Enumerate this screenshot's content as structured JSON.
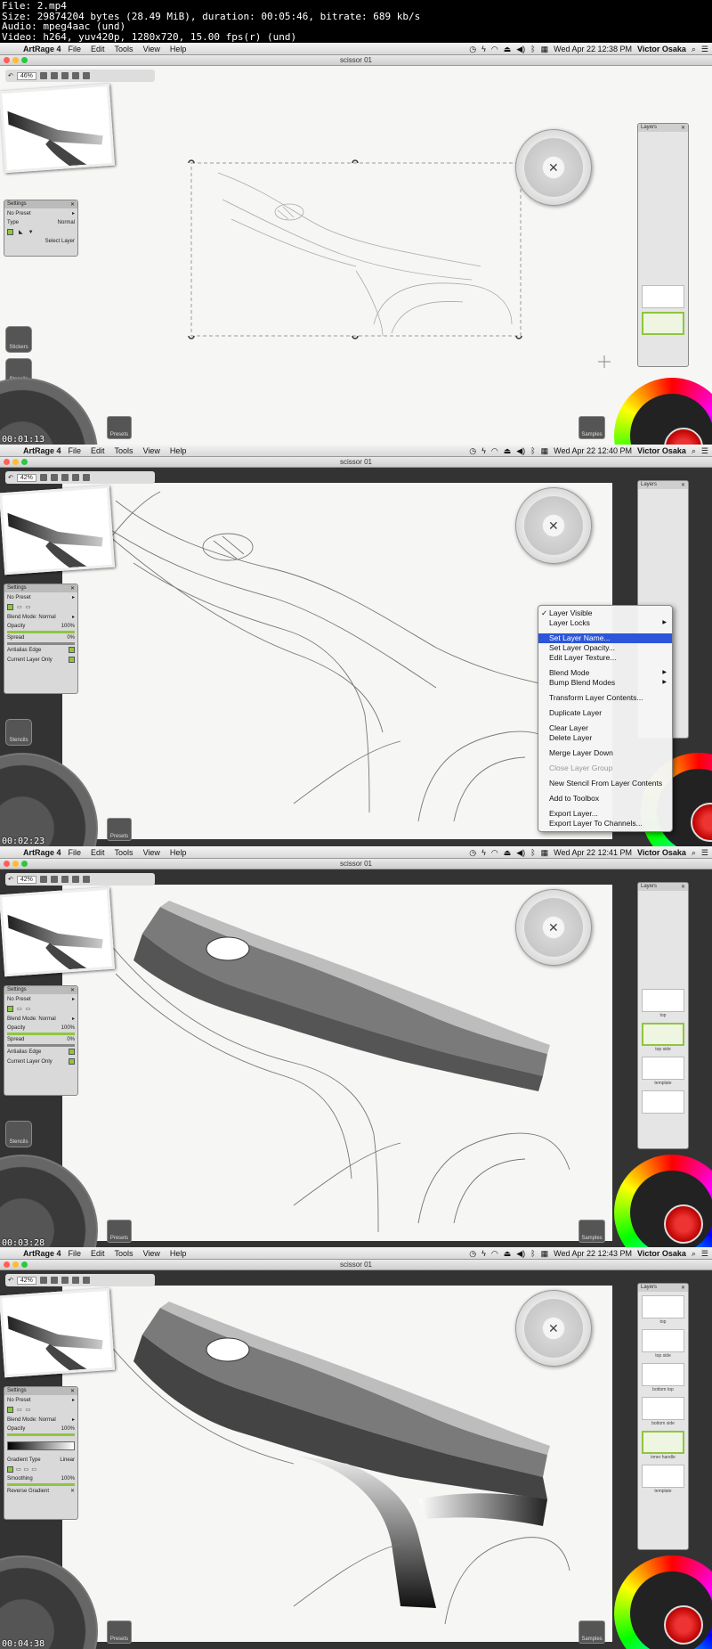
{
  "file_info": {
    "lines": [
      "File: 2.mp4",
      "Size: 29874204 bytes (28.49 MiB), duration: 00:05:46, bitrate: 689 kb/s",
      "Audio: mpeg4aac (und)",
      "Video: h264, yuv420p, 1280x720, 15.00 fps(r) (und)"
    ]
  },
  "menubar": {
    "app_name": "ArtRage 4",
    "items": [
      "File",
      "Edit",
      "Tools",
      "View",
      "Help"
    ],
    "user": "Victor Osaka"
  },
  "window_title": "scissor 01",
  "colors": {
    "accent_green": "#8ec63f",
    "menu_highlight": "#2b56d9",
    "close_light": "#ff5f57",
    "min_light": "#ffbd2e",
    "max_light": "#28c940"
  },
  "frames": [
    {
      "timecode": "00:01:13",
      "clock": "Wed Apr 22 12:38 PM",
      "zoom": "46%",
      "settings": {
        "title": "Settings",
        "preset": "No Preset",
        "type_label": "Type",
        "normal_label": "Normal",
        "select_layer": "Select Layer"
      },
      "side_buttons": [
        "Stickers",
        "Stencils"
      ],
      "layers_title": "Layers",
      "layer_names": []
    },
    {
      "timecode": "00:02:23",
      "clock": "Wed Apr 22 12:40 PM",
      "zoom": "42%",
      "settings": {
        "title": "Settings",
        "preset": "No Preset",
        "blend_mode": "Blend Mode: Normal",
        "opacity_label": "Opacity",
        "opacity_value": "100%",
        "spread_label": "Spread",
        "spread_value": "0%",
        "antialias": "Antialias Edge",
        "current_layer": "Current Layer Only"
      },
      "side_buttons": [
        "Stencils"
      ],
      "layers_title": "Layers",
      "layer_names": [],
      "context_menu": {
        "items": [
          {
            "label": "Layer Visible",
            "check": "✓"
          },
          {
            "label": "Layer Locks",
            "submenu": "▶"
          },
          {
            "sep": true
          },
          {
            "label": "Set Layer Name...",
            "selected": true
          },
          {
            "label": "Set Layer Opacity..."
          },
          {
            "label": "Edit Layer Texture..."
          },
          {
            "sep": true
          },
          {
            "label": "Blend Mode",
            "submenu": "▶"
          },
          {
            "label": "Bump Blend Modes",
            "submenu": "▶"
          },
          {
            "sep": true
          },
          {
            "label": "Transform Layer Contents..."
          },
          {
            "sep": true
          },
          {
            "label": "Duplicate Layer"
          },
          {
            "sep": true
          },
          {
            "label": "Clear Layer"
          },
          {
            "label": "Delete Layer"
          },
          {
            "sep": true
          },
          {
            "label": "Merge Layer Down"
          },
          {
            "sep": true
          },
          {
            "label": "Close Layer Group",
            "disabled": true
          },
          {
            "sep": true
          },
          {
            "label": "New Stencil From Layer Contents"
          },
          {
            "sep": true
          },
          {
            "label": "Add to Toolbox"
          },
          {
            "sep": true
          },
          {
            "label": "Export Layer..."
          },
          {
            "label": "Export Layer To Channels..."
          }
        ]
      }
    },
    {
      "timecode": "00:03:28",
      "clock": "Wed Apr 22 12:41 PM",
      "zoom": "42%",
      "settings": {
        "title": "Settings",
        "preset": "No Preset",
        "blend_mode": "Blend Mode: Normal",
        "opacity_label": "Opacity",
        "opacity_value": "100%",
        "spread_label": "Spread",
        "spread_value": "0%",
        "antialias": "Antialias Edge",
        "current_layer": "Current Layer Only"
      },
      "side_buttons": [
        "Stencils"
      ],
      "layers_title": "Layers",
      "layer_names": [
        "top",
        "top side",
        "template"
      ]
    },
    {
      "timecode": "00:04:38",
      "clock": "Wed Apr 22 12:43 PM",
      "zoom": "42%",
      "settings": {
        "title": "Settings",
        "preset": "No Preset",
        "blend_mode": "Blend Mode: Normal",
        "opacity_label": "Opacity",
        "opacity_value": "100%",
        "gradient_type": "Gradient Type",
        "gradient_value": "Linear",
        "smoothing_label": "Smoothing",
        "smoothing_value": "100%",
        "reverse": "Reverse Gradient"
      },
      "side_buttons": [],
      "layers_title": "Layers",
      "layer_names": [
        "top",
        "top side",
        "bottom top",
        "bottom side",
        "inner handle",
        "template"
      ]
    }
  ],
  "labels": {
    "presets": "Presets",
    "samples": "Samples"
  }
}
